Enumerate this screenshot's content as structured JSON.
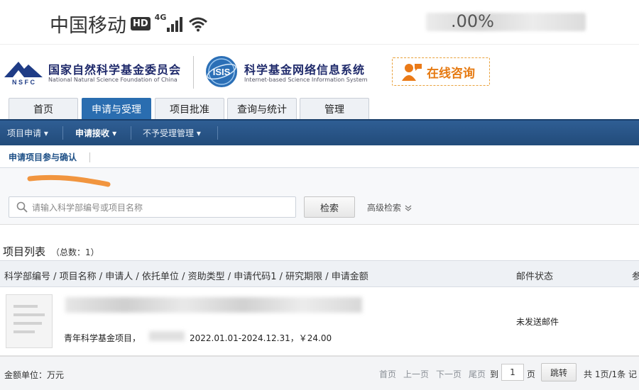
{
  "status_bar": {
    "carrier": "中国移动",
    "hd": "HD",
    "network": "4G",
    "battery": ".00%"
  },
  "header": {
    "nsfc_name": "国家自然科学基金委员会",
    "nsfc_english": "National Natural Science Foundation of China",
    "isis_name": "科学基金网络信息系统",
    "isis_english": "Internet-based Science Information System",
    "consult": "在线咨询"
  },
  "main_tabs": [
    {
      "label": "首页",
      "active": false
    },
    {
      "label": "申请与受理",
      "active": true
    },
    {
      "label": "项目批准",
      "active": false
    },
    {
      "label": "查询与统计",
      "active": false
    },
    {
      "label": "管理",
      "active": false
    }
  ],
  "sub_nav": [
    {
      "label": "项目申请 ▾",
      "active": false
    },
    {
      "label": "申请接收 ▾",
      "active": true
    },
    {
      "label": "不予受理管理 ▾",
      "active": false
    }
  ],
  "breadcrumb": "申请项目参与确认",
  "search": {
    "placeholder": "请输入科学部编号或项目名称",
    "button": "检索",
    "advanced": "高级检索"
  },
  "list": {
    "title": "项目列表",
    "count": "（总数：1）",
    "columns": {
      "main": "科学部编号 / 项目名称 / 申请人 / 依托单位 / 资助类型 / 申请代码1 / 研究期限 / 申请金额",
      "mail": "邮件状态",
      "more": "参"
    },
    "rows": [
      {
        "type": "青年科学基金项目，",
        "detail": "2022.01.01-2024.12.31，￥24.00",
        "mail_status": "未发送邮件"
      }
    ]
  },
  "footer": {
    "unit": "金额单位：万元",
    "first": "首页",
    "prev": "上一页",
    "next": "下一页",
    "last": "尾页",
    "goto": "到",
    "page_value": "1",
    "page_unit": "页",
    "jump": "跳转",
    "summary": "共 1页/1条 记"
  },
  "colors": {
    "nav_blue": "#224b7a",
    "tab_active": "#2a6db0",
    "consult_orange": "#e67a12"
  }
}
